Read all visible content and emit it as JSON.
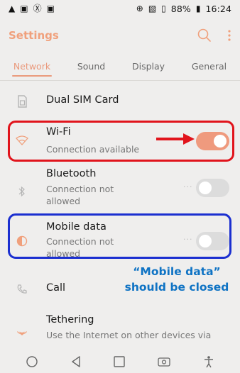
{
  "status_bar": {
    "left_icons": [
      "warning-icon",
      "gallery-icon",
      "accessibility-icon",
      "notification-icon"
    ],
    "right_icons": [
      "data-saver-icon",
      "nfc-icon",
      "signal-icon"
    ],
    "battery": "88%",
    "time": "16:24"
  },
  "header": {
    "title": "Settings"
  },
  "tabs": [
    {
      "label": "Network",
      "active": true
    },
    {
      "label": "Sound",
      "active": false
    },
    {
      "label": "Display",
      "active": false
    },
    {
      "label": "General",
      "active": false
    }
  ],
  "rows": {
    "dual_sim": {
      "title": "Dual SIM Card"
    },
    "wifi": {
      "title": "Wi-Fi",
      "subtitle": "Connection available",
      "toggle": "on"
    },
    "bluetooth": {
      "title": "Bluetooth",
      "subtitle": "Connection not allowed",
      "toggle": "off"
    },
    "mobile_data": {
      "title": "Mobile data",
      "subtitle": "Connection not allowed",
      "toggle": "off"
    },
    "call": {
      "title": "Call"
    },
    "tethering": {
      "title": "Tethering",
      "subtitle": "Use the Internet on other devices via"
    }
  },
  "annotation": {
    "line1": "“Mobile data”",
    "line2": "should be closed"
  },
  "colors": {
    "accent": "#ef9a7e",
    "red_box": "#e1141c",
    "blue_box": "#1b2fd0",
    "annotation_text": "#0f73c4"
  }
}
